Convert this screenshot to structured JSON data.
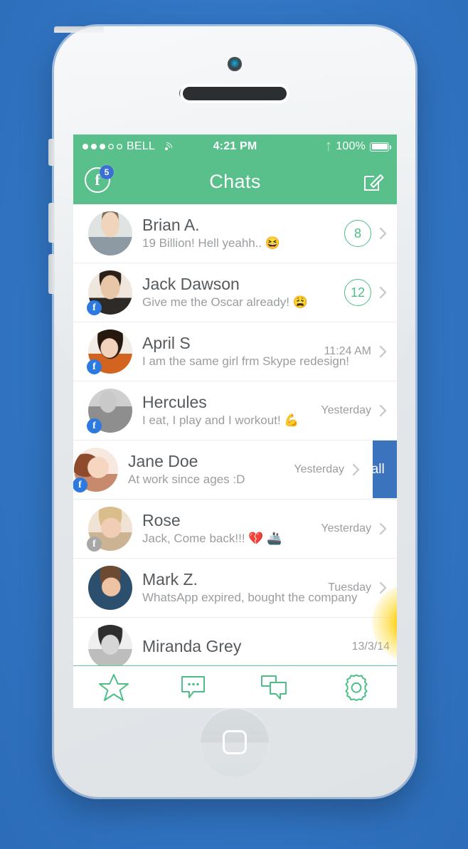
{
  "device": {
    "name": "white-smartphone",
    "home_button": "home-button",
    "camera": "front-camera",
    "speaker": "earpiece-speaker"
  },
  "colors": {
    "background_blue": "#3377c6",
    "header_green": "#59bf8b",
    "accent_green": "#4cbe86",
    "badge_blue": "#3b6fd4",
    "swipe_action_blue": "#3b74bd",
    "name_text": "#555a5e",
    "message_text": "#9a9da0",
    "touch_glow_yellow": "#ffd21a"
  },
  "statusbar": {
    "signal_dots_filled": 3,
    "signal_dots_total": 5,
    "carrier": "BELL",
    "wifi_icon": "wifi-icon",
    "time": "4:21 PM",
    "bluetooth_icon": "bluetooth-icon",
    "battery_percent": "100%",
    "battery_icon": "battery-full-icon"
  },
  "navbar": {
    "title": "Chats",
    "facebook_icon": "facebook-icon",
    "facebook_badge": "5",
    "compose_icon": "compose-icon"
  },
  "chats": [
    {
      "name": "Brian A.",
      "message": "19 Billion! Hell yeahh.. 😆",
      "time": "",
      "badge": "8",
      "fb_badge": "none",
      "avatar": "avatar-brian",
      "chevron": "chevron-right-icon"
    },
    {
      "name": "Jack Dawson",
      "message": "Give me the Oscar already! 😩",
      "time": "",
      "badge": "12",
      "fb_badge": "blue",
      "avatar": "avatar-jack",
      "chevron": "chevron-right-icon"
    },
    {
      "name": "April S",
      "message": "I am the same girl frm Skype redesign!",
      "time": "11:24 AM",
      "badge": "",
      "fb_badge": "blue",
      "avatar": "avatar-april",
      "chevron": "chevron-right-icon"
    },
    {
      "name": "Hercules",
      "message": "I eat, I play and I workout! 💪",
      "time": "Yesterday",
      "badge": "",
      "fb_badge": "blue",
      "avatar": "avatar-hercules",
      "chevron": "chevron-right-icon"
    },
    {
      "name": "Jane Doe",
      "message": "At work since ages :D",
      "time": "Yesterday",
      "badge": "",
      "fb_badge": "blue",
      "avatar": "avatar-jane",
      "chevron": "chevron-right-icon",
      "swiped": true,
      "swipe_action_label": "Call"
    },
    {
      "name": "Rose",
      "message": "Jack, Come back!!! 💔 🚢",
      "time": "Yesterday",
      "badge": "",
      "fb_badge": "grey",
      "avatar": "avatar-rose",
      "chevron": "chevron-right-icon"
    },
    {
      "name": "Mark Z.",
      "message": "WhatsApp expired, bought the company",
      "time": "Tuesday",
      "badge": "",
      "fb_badge": "none",
      "avatar": "avatar-mark",
      "chevron": "chevron-right-icon"
    },
    {
      "name": "Miranda Grey",
      "message": "",
      "time": "13/3/14",
      "badge": "",
      "fb_badge": "none",
      "avatar": "avatar-miranda",
      "chevron": ""
    }
  ],
  "tabbar": [
    {
      "icon": "star-icon",
      "label": "Favorites",
      "active": false
    },
    {
      "icon": "chat-bubble-icon",
      "label": "Chats",
      "active": true
    },
    {
      "icon": "group-chat-icon",
      "label": "Groups",
      "active": false
    },
    {
      "icon": "gear-icon",
      "label": "Settings",
      "active": false
    }
  ]
}
